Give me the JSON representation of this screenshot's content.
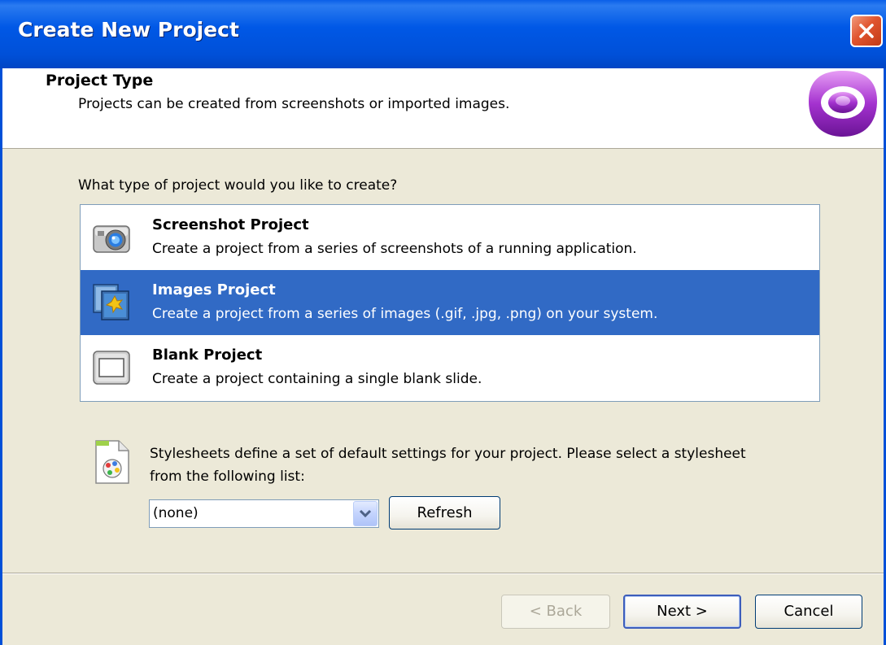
{
  "window": {
    "title": "Create New Project"
  },
  "header": {
    "title": "Project Type",
    "description": "Projects can be created from screenshots or imported images."
  },
  "body": {
    "question": "What type of project would you like to create?",
    "project_types": [
      {
        "title": "Screenshot Project",
        "description": "Create a project from a series of screenshots of a running application.",
        "icon": "camera-icon",
        "selected": false
      },
      {
        "title": "Images Project",
        "description": "Create a project from a series of images (.gif, .jpg, .png) on your system.",
        "icon": "images-icon",
        "selected": true
      },
      {
        "title": "Blank Project",
        "description": "Create a project containing a single blank slide.",
        "icon": "blank-slide-icon",
        "selected": false
      }
    ],
    "stylesheet": {
      "text": "Stylesheets define a set of default settings for your project. Please select a stylesheet from the following list:",
      "selected_value": "(none)",
      "refresh_label": "Refresh"
    }
  },
  "footer": {
    "back_label": "< Back",
    "next_label": "Next >",
    "cancel_label": "Cancel"
  },
  "colors": {
    "titlebar": "#0058e6",
    "selection": "#316ac5",
    "dialog_bg": "#ece9d8",
    "logo_purple": "#9b2fc4"
  }
}
